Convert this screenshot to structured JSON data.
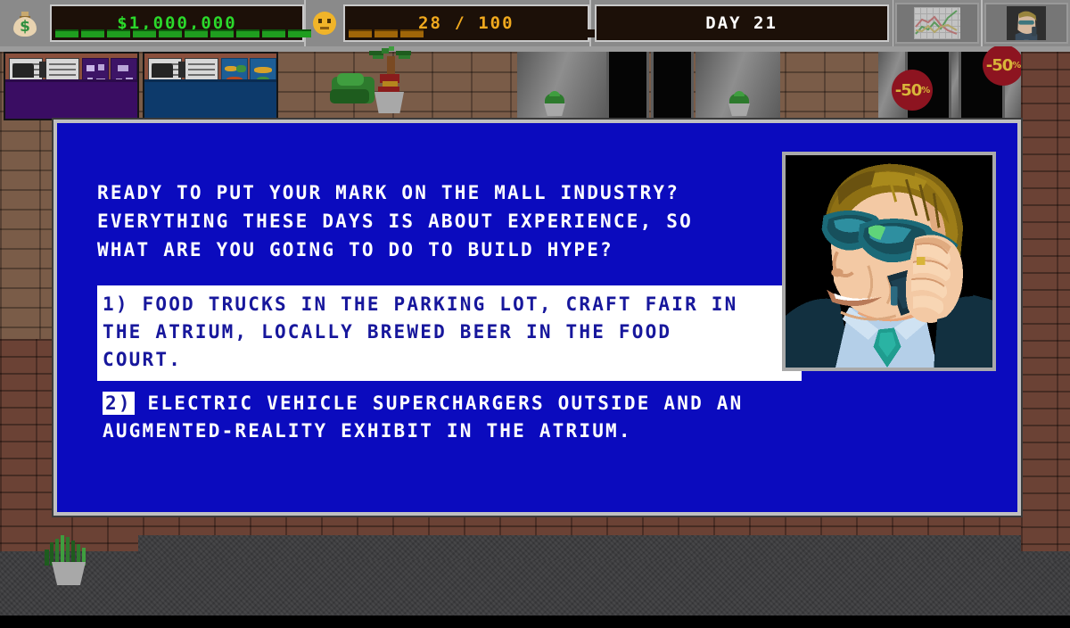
{
  "hud": {
    "money": {
      "icon": "money-bag-icon",
      "value": "$1,000,000",
      "segments_total": 10,
      "segments_filled": 10,
      "color": "#1f9e1f"
    },
    "happiness": {
      "icon": "neutral-face-icon",
      "value": "28 / 100",
      "segments_total": 10,
      "segments_filled": 3,
      "color": "#a06608"
    },
    "day": {
      "value": "DAY 21"
    },
    "buttons": [
      {
        "name": "stats-chart-button",
        "icon": "line-chart-icon"
      },
      {
        "name": "advisor-portrait-button",
        "icon": "advisor-portrait-icon"
      }
    ]
  },
  "dialog": {
    "prompt_lines": [
      "READY TO PUT YOUR MARK ON THE MALL INDUSTRY?",
      "EVERYTHING THESE DAYS IS ABOUT EXPERIENCE, SO",
      "WHAT ARE YOU GOING TO DO TO BUILD HYPE?"
    ],
    "options": [
      {
        "marker": "1)",
        "selected": true,
        "lines": [
          "1)  FOOD TRUCKS IN THE PARKING LOT, CRAFT FAIR IN",
          "THE ATRIUM, LOCALLY BREWED BEER IN THE FOOD",
          "COURT."
        ]
      },
      {
        "marker": "2)",
        "selected": false,
        "lines": [
          " ELECTRIC VEHICLE SUPERCHARGERS OUTSIDE AND AN",
          "AUGMENTED-REALITY EXHIBIT IN THE ATRIUM."
        ]
      }
    ],
    "portrait": {
      "name": "advisor-portrait",
      "description": "MAN WITH SUNGLASSES ON PHONE"
    },
    "colors": {
      "background": "#0b0bbe",
      "border": "#c0c0c0",
      "text": "#ffffff",
      "selected_bg": "#ffffff",
      "selected_text": "#17179c"
    }
  },
  "scene": {
    "sale_signs": [
      {
        "label": "-50",
        "pct": "%"
      },
      {
        "label": "-50",
        "pct": "%"
      }
    ],
    "shops": [
      {
        "name": "shop-front-purple"
      },
      {
        "name": "shop-front-blue"
      }
    ]
  }
}
